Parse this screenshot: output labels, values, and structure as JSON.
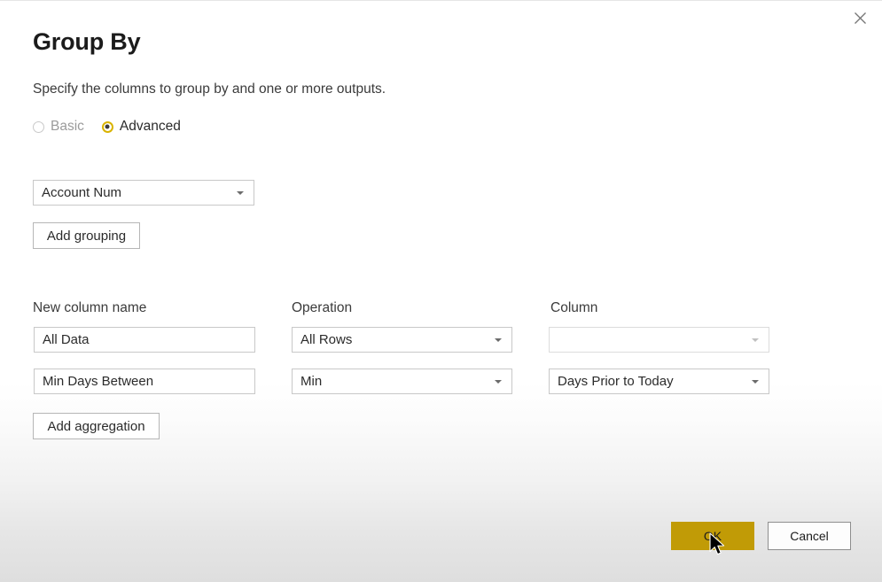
{
  "dialog": {
    "title": "Group By",
    "subtitle": "Specify the columns to group by and one or more outputs.",
    "close_icon": "close-icon"
  },
  "mode": {
    "options": [
      {
        "label": "Basic",
        "selected": false
      },
      {
        "label": "Advanced",
        "selected": true
      }
    ]
  },
  "grouping": {
    "dropdown_value": "Account Num",
    "add_button_label": "Add grouping"
  },
  "aggregations": {
    "headers": {
      "new_column_name": "New column name",
      "operation": "Operation",
      "column": "Column"
    },
    "rows": [
      {
        "new_column_name": "All Data",
        "operation": "All Rows",
        "column": ""
      },
      {
        "new_column_name": "Min Days Between",
        "operation": "Min",
        "column": "Days Prior to Today"
      }
    ],
    "add_button_label": "Add aggregation"
  },
  "footer": {
    "ok_label": "OK",
    "cancel_label": "Cancel"
  },
  "colors": {
    "accent": "#c19b06",
    "radio_selected_ring": "#d9b300",
    "dialog_background": "#ffffff",
    "footer_background": "#dedede"
  },
  "icons": {
    "dropdown_caret": "chevron-down-icon",
    "mouse_pointer": "mouse-pointer-icon"
  }
}
